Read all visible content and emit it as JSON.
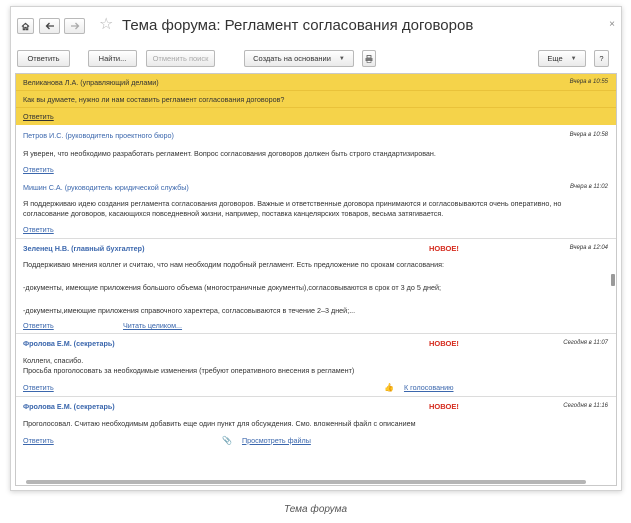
{
  "window": {
    "title": "Тема форума: Регламент согласования договоров",
    "home_icon": "home-icon",
    "back_icon": "arrow-left-icon",
    "forward_icon": "arrow-right-icon",
    "favorite_icon": "star-icon",
    "close_icon": "close-icon"
  },
  "toolbar": {
    "reply": "Ответить",
    "find": "Найти...",
    "cancel_search": "Отменить поиск",
    "create_based": "Создать на основании",
    "print_icon": "printer-icon",
    "more": "Еще",
    "help": "?"
  },
  "posts": [
    {
      "author": "Великанова Л.А. (управляющий делами)",
      "time": "Вчера в 10:55",
      "text": [
        "Как вы думаете, нужно ли нам составить регламент согласования договоров?"
      ],
      "reply": "Ответить"
    },
    {
      "author": "Петров И.С. (руководитель проектного бюро)",
      "time": "Вчера в 10:58",
      "text": [
        "Я уверен, что необходимо разработать регламент. Вопрос согласования договоров должен быть строго стандартизирован."
      ],
      "reply": "Ответить"
    },
    {
      "author": "Мишин С.А. (руководитель юридической службы)",
      "time": "Вчера в 11:02",
      "text": [
        "Я поддерживаю идею создания регламента согласования договоров. Важные и ответственные договора принимаются и согласовываются очень оперативно, но согласование договоров, касающихся повседневной жизни, например, поставка канцелярских товаров, весьма затягивается."
      ],
      "reply": "Ответить"
    },
    {
      "author": "Зеленец Н.В. (главный бухгалтер)",
      "badge": "НОВОЕ!",
      "time": "Вчера в 12:04",
      "text": [
        "Поддерживаю мнения коллег и считаю, что нам необходим подобный регламент. Есть предложение по срокам согласования:",
        "-документы, имеющие приложения большого объема (многостраничные документы),согласовываются в срок от 3 до 5 дней;",
        "-документы,имеющие приложения справочного харектера, согласовываются в течение 2–3 дней;..."
      ],
      "reply": "Ответить",
      "extra_link": "Читать целиком..."
    },
    {
      "author": "Фролова Е.М. (секретарь)",
      "badge": "НОВОЕ!",
      "time": "Сегодня в 11:07",
      "text": [
        "Коллеги, спасибо.",
        "Просьба проголосовать за необходимые изменения (требуют оперативного внесения в регламент)"
      ],
      "reply": "Ответить",
      "extra_icon": "thumbs-up-icon",
      "extra_link": "К голосованию"
    },
    {
      "author": "Фролова Е.М. (секретарь)",
      "badge": "НОВОЕ!",
      "time": "Сегодня в 11:16",
      "text": [
        "Проголосовал. Считаю необходимым добавить еще один пункт для обсуждения. Смо. вложенный файл с описанием"
      ],
      "reply": "Ответить",
      "extra_icon": "paperclip-icon",
      "extra_link": "Просмотреть файлы"
    }
  ],
  "caption": "Тема форума"
}
